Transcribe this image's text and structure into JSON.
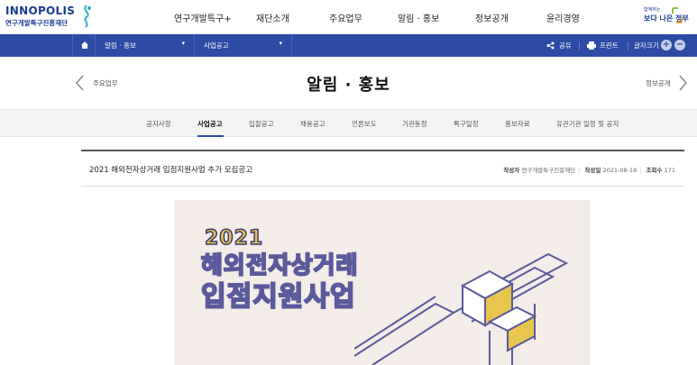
{
  "header": {
    "logo": {
      "main": "INNOPOLIS",
      "sub": "연구개발특구진흥재단"
    },
    "gnb": [
      "연구개발특구+",
      "재단소개",
      "주요업무",
      "알림 · 홍보",
      "정보공개",
      "윤리경영"
    ],
    "gov_logo": {
      "small": "함께하는",
      "big": "보다 나은 정부"
    }
  },
  "bar": {
    "home_icon": "home-icon",
    "selects": [
      "알림 · 홍보",
      "사업공고"
    ],
    "share_label": "공유",
    "print_label": "프린트",
    "font_size_label": "글자크기",
    "plus": "+",
    "minus": "−"
  },
  "title_row": {
    "prev_label": "주요업무",
    "title": "알림 · 홍보",
    "next_label": "정보공개"
  },
  "tabs": {
    "items": [
      "공지사항",
      "사업공고",
      "입찰공고",
      "채용공고",
      "언론보도",
      "기관동정",
      "특구일정",
      "홍보자료",
      "유관기관 일정 및 공지"
    ],
    "active_index": 1
  },
  "post": {
    "title": "2021 해외전자상거래 입점지원사업 추가 모집공고",
    "author_label": "작성자",
    "author": "연구개발특구진흥재단",
    "date_label": "작성일",
    "date": "2021-08-19",
    "views_label": "조회수",
    "views": "171"
  },
  "poster": {
    "year": "2021",
    "line1": "해외전자상거래",
    "line2": "입점지원사업"
  },
  "colors": {
    "brand_blue": "#2b4ba5",
    "poster_bg": "#f3ece8",
    "poster_yellow": "#e8c64d",
    "poster_purple": "#5a5a9c"
  }
}
